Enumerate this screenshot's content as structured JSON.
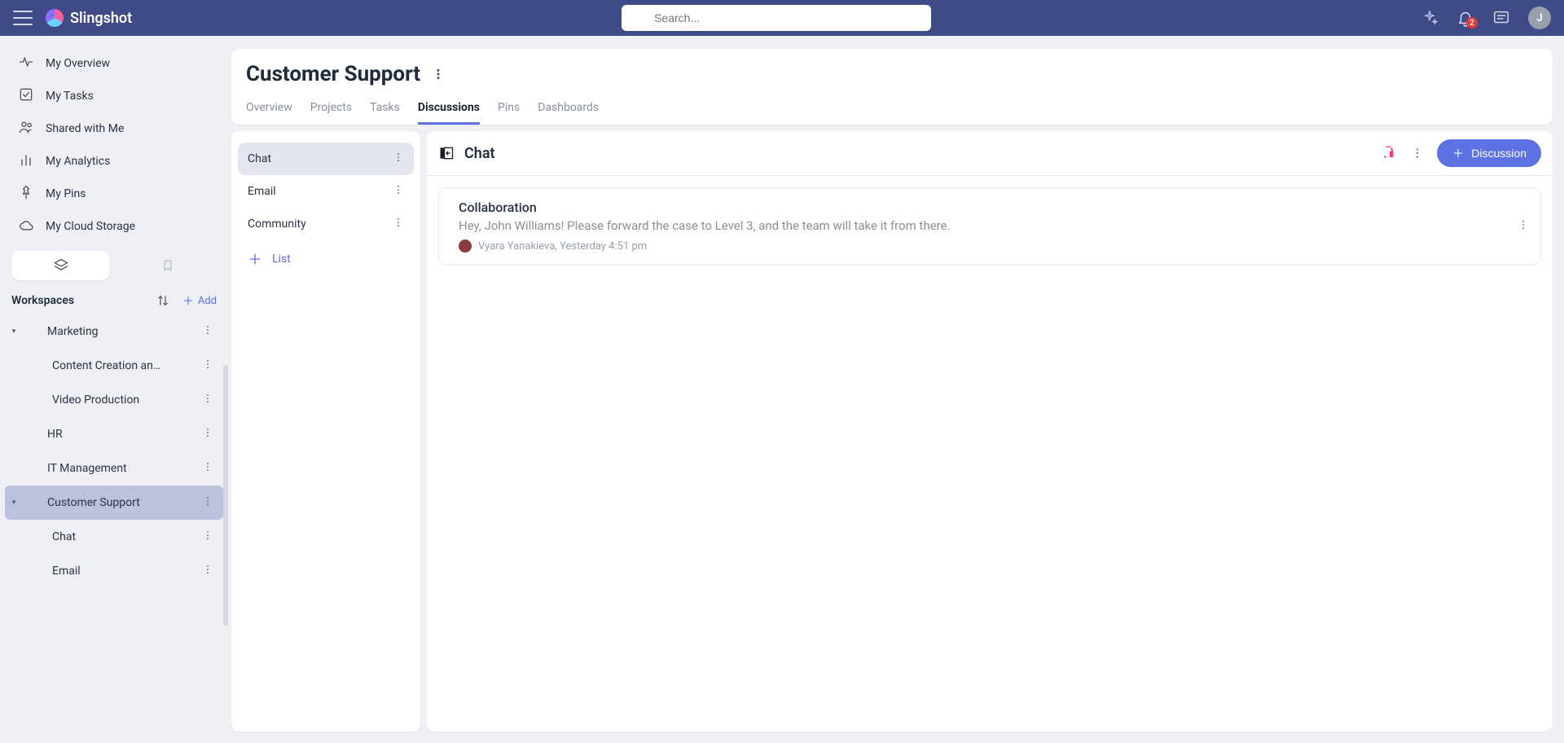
{
  "topnav": {
    "brand": "Slingshot",
    "search_placeholder": "Search...",
    "notif_count": "2",
    "avatar_initial": "J"
  },
  "sidebar": {
    "nav": [
      {
        "label": "My Overview",
        "icon": "activity"
      },
      {
        "label": "My Tasks",
        "icon": "check-square"
      },
      {
        "label": "Shared with Me",
        "icon": "users"
      },
      {
        "label": "My Analytics",
        "icon": "bar-chart"
      },
      {
        "label": "My Pins",
        "icon": "pin"
      },
      {
        "label": "My Cloud Storage",
        "icon": "cloud"
      }
    ],
    "section_title": "Workspaces",
    "add_label": "Add",
    "tree": [
      {
        "label": "Marketing",
        "expanded": true,
        "children": [
          {
            "label": "Content Creation an…"
          },
          {
            "label": "Video Production"
          }
        ]
      },
      {
        "label": "HR"
      },
      {
        "label": "IT Management"
      },
      {
        "label": "Customer Support",
        "expanded": true,
        "selected": true,
        "children": [
          {
            "label": "Chat"
          },
          {
            "label": "Email"
          }
        ]
      }
    ]
  },
  "header": {
    "title": "Customer Support",
    "tabs": [
      "Overview",
      "Projects",
      "Tasks",
      "Discussions",
      "Pins",
      "Dashboards"
    ],
    "active_tab": "Discussions"
  },
  "lists": {
    "items": [
      "Chat",
      "Email",
      "Community"
    ],
    "active": "Chat",
    "add_label": "List"
  },
  "chat": {
    "title": "Chat",
    "discussion_button": "Discussion",
    "threads": [
      {
        "title": "Collaboration",
        "preview": "Hey, John Williams! Please forward the case to Level 3, and the team will take it from there.",
        "author": "Vyara Yanakieva",
        "time": "Yesterday 4:51 pm"
      }
    ]
  }
}
